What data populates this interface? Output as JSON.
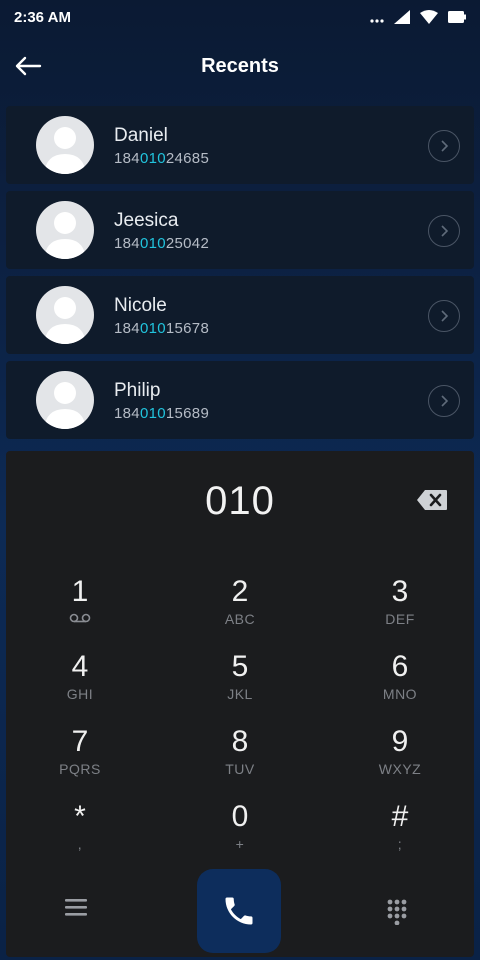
{
  "status": {
    "time": "2:36 AM"
  },
  "header": {
    "title": "Recents"
  },
  "contacts": [
    {
      "name": "Daniel",
      "num_prefix": "184",
      "num_match": "010",
      "num_suffix": "24685"
    },
    {
      "name": "Jeesica",
      "num_prefix": "184",
      "num_match": "010",
      "num_suffix": "25042"
    },
    {
      "name": "Nicole",
      "num_prefix": "184",
      "num_match": "010",
      "num_suffix": "15678"
    },
    {
      "name": "Philip",
      "num_prefix": "184",
      "num_match": "010",
      "num_suffix": "15689"
    }
  ],
  "dialpad": {
    "display": "010",
    "keys": [
      {
        "digit": "1",
        "letters": ""
      },
      {
        "digit": "2",
        "letters": "ABC"
      },
      {
        "digit": "3",
        "letters": "DEF"
      },
      {
        "digit": "4",
        "letters": "GHI"
      },
      {
        "digit": "5",
        "letters": "JKL"
      },
      {
        "digit": "6",
        "letters": "MNO"
      },
      {
        "digit": "7",
        "letters": "PQRS"
      },
      {
        "digit": "8",
        "letters": "TUV"
      },
      {
        "digit": "9",
        "letters": "WXYZ"
      },
      {
        "digit": "*",
        "letters": ","
      },
      {
        "digit": "0",
        "letters": "+"
      },
      {
        "digit": "#",
        "letters": ";"
      }
    ]
  },
  "colors": {
    "highlight": "#21c4dd",
    "call_button": "#0d2d5c"
  },
  "icons": [
    "back-arrow-icon",
    "chevron-right-icon",
    "backspace-icon",
    "voicemail-icon",
    "menu-icon",
    "phone-icon",
    "keypad-icon"
  ]
}
